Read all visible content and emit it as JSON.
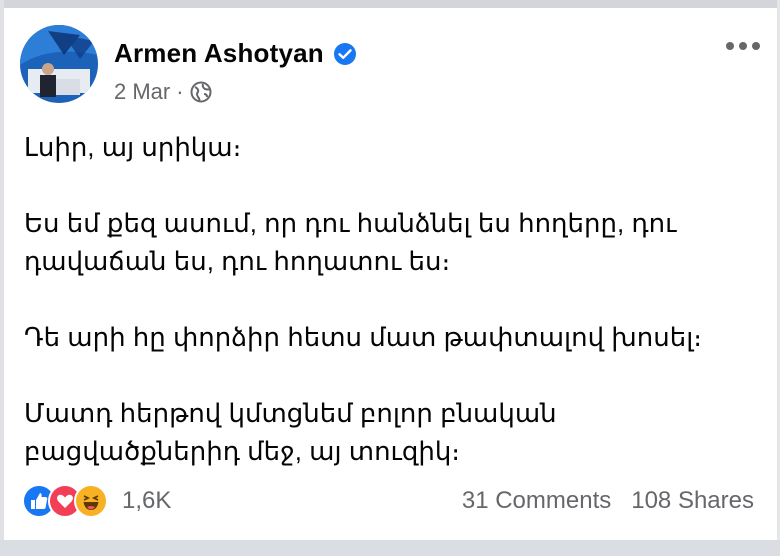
{
  "post": {
    "author": "Armen Ashotyan",
    "date": "2 Mar",
    "separator": "·",
    "lines": [
      "Լսիր, այ սրիկա։",
      "Ես եմ քեզ ասում, որ դու հանձնել ես հողերը, դու",
      "դավաճան ես, դու հողատու ես։",
      "Դե արի հը փորձիր հետս մատ թափտալով խոսել։",
      "Մատդ հերթով կմտցնեմ բոլոր բնական",
      "բացվածքներիդ մեջ, այ տուզիկ։"
    ]
  },
  "footer": {
    "reaction_count": "1,6K",
    "comments": "31 Comments",
    "shares": "108 Shares"
  },
  "icons": {
    "like": "like-icon",
    "love": "love-icon",
    "haha": "haha-icon",
    "verified": "verified-badge-icon",
    "audience": "globe-icon",
    "more": "more-options-icon"
  },
  "colors": {
    "verified": "#1877f2",
    "like": "#1877f2",
    "love": "#f33e58",
    "haha": "#f7b125",
    "muted": "#65676b"
  }
}
